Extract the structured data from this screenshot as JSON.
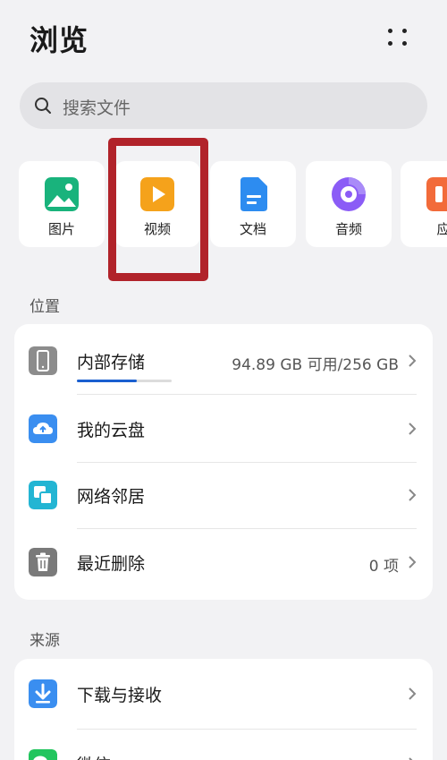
{
  "header": {
    "title": "浏览",
    "menu_icon": "more-vertical-icon"
  },
  "search": {
    "placeholder": "搜索文件",
    "icon": "search-icon"
  },
  "categories": [
    {
      "label": "图片",
      "icon": "image-icon",
      "color": "#19b37c"
    },
    {
      "label": "视频",
      "icon": "video-icon",
      "color": "#f5a21b"
    },
    {
      "label": "文档",
      "icon": "document-icon",
      "color": "#2d8cf0"
    },
    {
      "label": "音频",
      "icon": "audio-icon",
      "color": "#8b5cf6"
    },
    {
      "label": "应",
      "icon": "app-icon",
      "color": "#f26b3a"
    }
  ],
  "highlight": {
    "target": "视频",
    "color": "#b1232a"
  },
  "sections": {
    "location": {
      "label": "位置",
      "items": [
        {
          "label": "内部存储",
          "value": "94.89 GB 可用/256 GB",
          "icon": "phone-icon",
          "icon_color": "#8c8c8c",
          "usage_fraction": 0.63
        },
        {
          "label": "我的云盘",
          "value": "",
          "icon": "cloud-icon",
          "icon_color": "#3a8ef0"
        },
        {
          "label": "网络邻居",
          "value": "",
          "icon": "network-icon",
          "icon_color": "#23b5d3"
        },
        {
          "label": "最近删除",
          "value": "0 项",
          "icon": "trash-icon",
          "icon_color": "#7a7a7a"
        }
      ]
    },
    "source": {
      "label": "来源",
      "items": [
        {
          "label": "下载与接收",
          "value": "",
          "icon": "download-icon",
          "icon_color": "#3a8ef0"
        },
        {
          "label": "微信",
          "value": "",
          "icon": "wechat-icon",
          "icon_color": "#22c55e"
        }
      ]
    }
  }
}
